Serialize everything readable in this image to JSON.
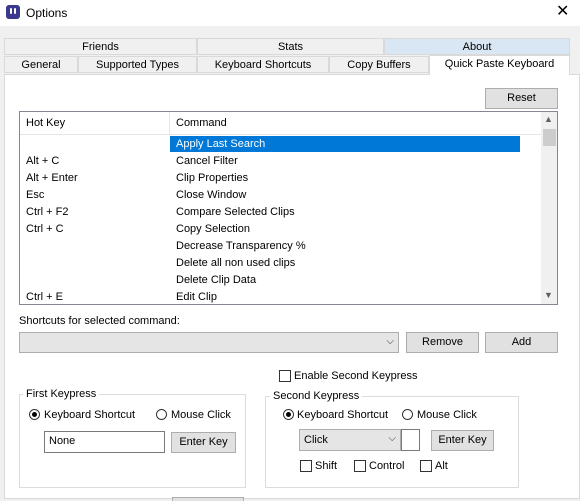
{
  "window": {
    "title": "Options"
  },
  "tabs_row1": [
    "Friends",
    "Stats",
    "About"
  ],
  "tabs_row2": [
    "General",
    "Supported Types",
    "Keyboard Shortcuts",
    "Copy Buffers",
    "Quick Paste Keyboard"
  ],
  "reset_label": "Reset",
  "list": {
    "headers": {
      "hot_key": "Hot Key",
      "command": "Command"
    },
    "rows": [
      {
        "hot_key": "",
        "command": "Apply Last Search"
      },
      {
        "hot_key": "Alt + C",
        "command": "Cancel Filter"
      },
      {
        "hot_key": "Alt + Enter",
        "command": "Clip Properties"
      },
      {
        "hot_key": "Esc",
        "command": "Close Window"
      },
      {
        "hot_key": "Ctrl + F2",
        "command": "Compare Selected Clips"
      },
      {
        "hot_key": "Ctrl + C",
        "command": "Copy Selection"
      },
      {
        "hot_key": "",
        "command": "Decrease Transparency %"
      },
      {
        "hot_key": "",
        "command": "Delete all non used clips"
      },
      {
        "hot_key": "",
        "command": "Delete Clip Data"
      },
      {
        "hot_key": "Ctrl + E",
        "command": "Edit Clip"
      }
    ]
  },
  "shortcuts_label": "Shortcuts for selected command:",
  "shortcuts_value": "",
  "remove_label": "Remove",
  "add_label": "Add",
  "enable_second_label": "Enable Second Keypress",
  "first": {
    "title": "First Keypress",
    "keyboard_shortcut": "Keyboard Shortcut",
    "mouse_click": "Mouse Click",
    "value": "None",
    "enter_key": "Enter Key"
  },
  "second": {
    "title": "Second Keypress",
    "keyboard_shortcut": "Keyboard Shortcut",
    "mouse_click": "Mouse Click",
    "click_value": "Click",
    "enter_key": "Enter Key",
    "shift": "Shift",
    "control": "Control",
    "alt": "Alt"
  }
}
